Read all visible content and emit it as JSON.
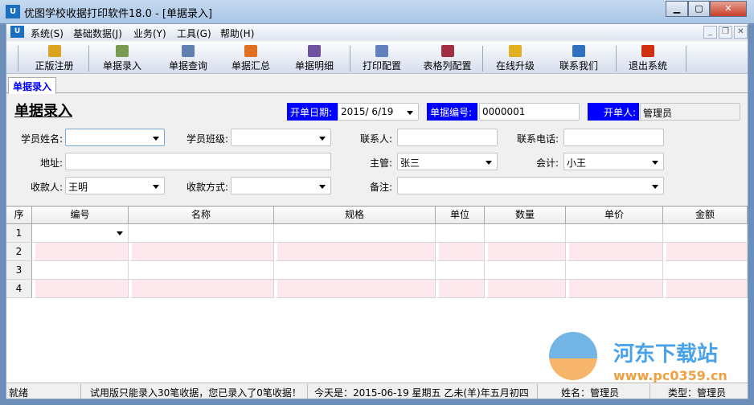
{
  "window": {
    "title": "优图学校收据打印软件18.0 - [单据录入]",
    "logo": "U"
  },
  "menu": [
    "系统(S)",
    "基础数据(J)",
    "业务(Y)",
    "工具(G)",
    "帮助(H)"
  ],
  "toolbar": [
    {
      "label": "正版注册",
      "icon": "lock-icon",
      "color": "#d9a520"
    },
    {
      "label": "单据录入",
      "icon": "form-edit-icon",
      "color": "#7a9a50"
    },
    {
      "label": "单据查询",
      "icon": "document-icon",
      "color": "#6080b0"
    },
    {
      "label": "单据汇总",
      "icon": "bar-chart-icon",
      "color": "#e07020"
    },
    {
      "label": "单据明细",
      "icon": "column-chart-icon",
      "color": "#7050a0"
    },
    {
      "label": "打印配置",
      "icon": "list-config-icon",
      "color": "#6080c0"
    },
    {
      "label": "表格列配置",
      "icon": "table-config-icon",
      "color": "#a03040"
    },
    {
      "label": "在线升级",
      "icon": "upgrade-icon",
      "color": "#e0b020"
    },
    {
      "label": "联系我们",
      "icon": "home-icon",
      "color": "#3070c0"
    },
    {
      "label": "退出系统",
      "icon": "exit-icon",
      "color": "#d03010"
    }
  ],
  "tab": "单据录入",
  "form": {
    "title": "单据录入",
    "date_label": "开单日期:",
    "date_value": "2015/  6/19",
    "no_label": "单据编号:",
    "no_value": "0000001",
    "creator_label": "开单人:",
    "creator_value": "管理员",
    "student_name_label": "学员姓名:",
    "student_name_value": "",
    "class_label": "学员班级:",
    "class_value": "",
    "contact_label": "联系人:",
    "contact_value": "",
    "phone_label": "联系电话:",
    "phone_value": "",
    "address_label": "地址:",
    "address_value": "",
    "supervisor_label": "主管:",
    "supervisor_value": "张三",
    "accountant_label": "会计:",
    "accountant_value": "小王",
    "payee_label": "收款人:",
    "payee_value": "王明",
    "paymethod_label": "收款方式:",
    "paymethod_value": "",
    "remark_label": "备注:",
    "remark_value": ""
  },
  "grid": {
    "headers": [
      "序",
      "编号",
      "名称",
      "规格",
      "单位",
      "数量",
      "单价",
      "金额"
    ],
    "rows": [
      "1",
      "2",
      "3",
      "4"
    ]
  },
  "watermark": {
    "name": "河东下载站",
    "url": "www.pc0359.cn"
  },
  "status": {
    "ready": "就绪",
    "trial": "试用版只能录入30笔收据，您已录入了0笔收据！",
    "today": "今天是：2015-06-19 星期五 乙未(羊)年五月初四",
    "name": "姓名：管理员",
    "type": "类型：管理员"
  }
}
